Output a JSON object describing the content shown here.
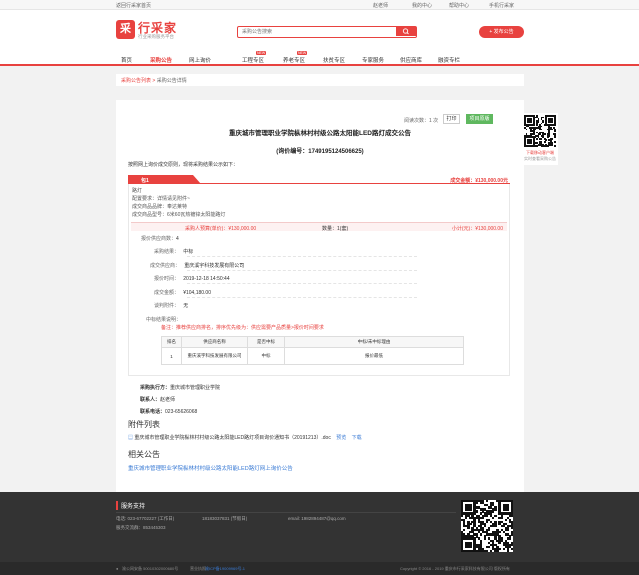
{
  "topbar": {
    "home": "返回行采家首页",
    "user": "赵老师",
    "user_center": "我的中心",
    "help_center": "帮助中心",
    "mobile": "手机行采家"
  },
  "header": {
    "logo_glyph": "采",
    "logo_name": "行采家",
    "slogan": "行业采购服务平台",
    "search_placeholder": "采购公告搜索",
    "publish_label": "发布公告"
  },
  "nav": {
    "items": [
      {
        "label": "首页",
        "active": false
      },
      {
        "label": "采购公告",
        "active": true
      },
      {
        "label": "网上询价",
        "active": false
      },
      {
        "label": "工程专区",
        "active": false
      },
      {
        "label": "养老专区",
        "active": false
      },
      {
        "label": "扶贫专区",
        "active": false
      },
      {
        "label": "专家服务",
        "active": false
      },
      {
        "label": "供应商库",
        "active": false
      },
      {
        "label": "融资专栏",
        "active": false
      }
    ],
    "tag": "NEW"
  },
  "breadcrumb": {
    "root": "采购公告列表",
    "sep": ">",
    "current": "采购公告详情"
  },
  "notice": {
    "read_count": "阅读次数：1 次",
    "print_label": "打印",
    "original_label": "项目原版",
    "title": "重庆城市管理职业学院枞林村村级公路太阳能LED路灯成交公告",
    "bid_no": "(询价编号：1749195124506625)",
    "intro": "按照网上询价成交原则，现将采购结果公示如下：",
    "package_tab": "包1",
    "package_amount": "成交金额：¥130,000.00元",
    "lines": [
      "路灯",
      "配置要求：详情请见附件~",
      "成交商品品牌：奉达莱特",
      "成交商品型号：6米60瓦热镀锌太阳能路灯"
    ],
    "price_left": "采购人预算(单价)：¥130,000.00",
    "price_mid": "数量：1(套)",
    "price_right": "小计(元)：¥130,000.00",
    "supplier_count_label": "报价供应商数：",
    "supplier_count": "4",
    "result_label": "采购结果：",
    "result": "中标",
    "winner_label": "成交供应商：",
    "winner": "重庆溪宇科技发展有限公司",
    "time_label": "报价时间：",
    "time": "2019-12-18 14:50:44",
    "amount_label": "成交金额：",
    "amount": "¥104,180.00",
    "attachment_label": "谈判附件：",
    "attachment": "无",
    "reason_label": "中标结果说明：",
    "remark": "备注：推荐供应商排名，排序优先级为：供应需要产品质量>报价时间要求",
    "table_headers": [
      "排名",
      "供应商名称",
      "是否中标",
      "中标/未中标理由"
    ],
    "table_rows": [
      [
        "1",
        "重庆溪宇科技发展有限公司",
        "中标",
        "报价最低"
      ]
    ],
    "exec_label": "采购执行方：",
    "exec": "重庆城市管理职业学院",
    "contact_label": "联系人：",
    "contact": "赵老师",
    "phone_label": "联系电话：",
    "phone": "023-65626068",
    "attach_title": "附件列表",
    "attach_file": "重庆城市管理职业学院枞林村村级公路太阳能LED路灯项目询价通知书（20191213）.doc",
    "attach_preview": "预览",
    "attach_download": "下载",
    "related_title": "相关公告",
    "related_item": "重庆城市管理职业学院枞林村村级公路太阳能LED路灯网上询价公告"
  },
  "qrcard": {
    "red": "下载移动客户端",
    "grey": "实时查看采购公告"
  },
  "footer": {
    "heading": "服务支持",
    "phone1": "电话: 023-67702227 (工作日)",
    "phone2": "18183037831 (节假日)",
    "email": "email: 1982894487@qq.com",
    "qq": "服务交流群：853445303"
  },
  "bottom": {
    "icp": "渝公网安备 50010302000680号",
    "license": "营业执照",
    "police": "渝ICP备19009969号-1",
    "copyright": "Copyright © 2016 - 2019 重庆市行采家科技有限公司 版权所有"
  },
  "colors": {
    "accent": "#e8423f",
    "green": "#5fb85f",
    "link": "#3a7bd5"
  }
}
